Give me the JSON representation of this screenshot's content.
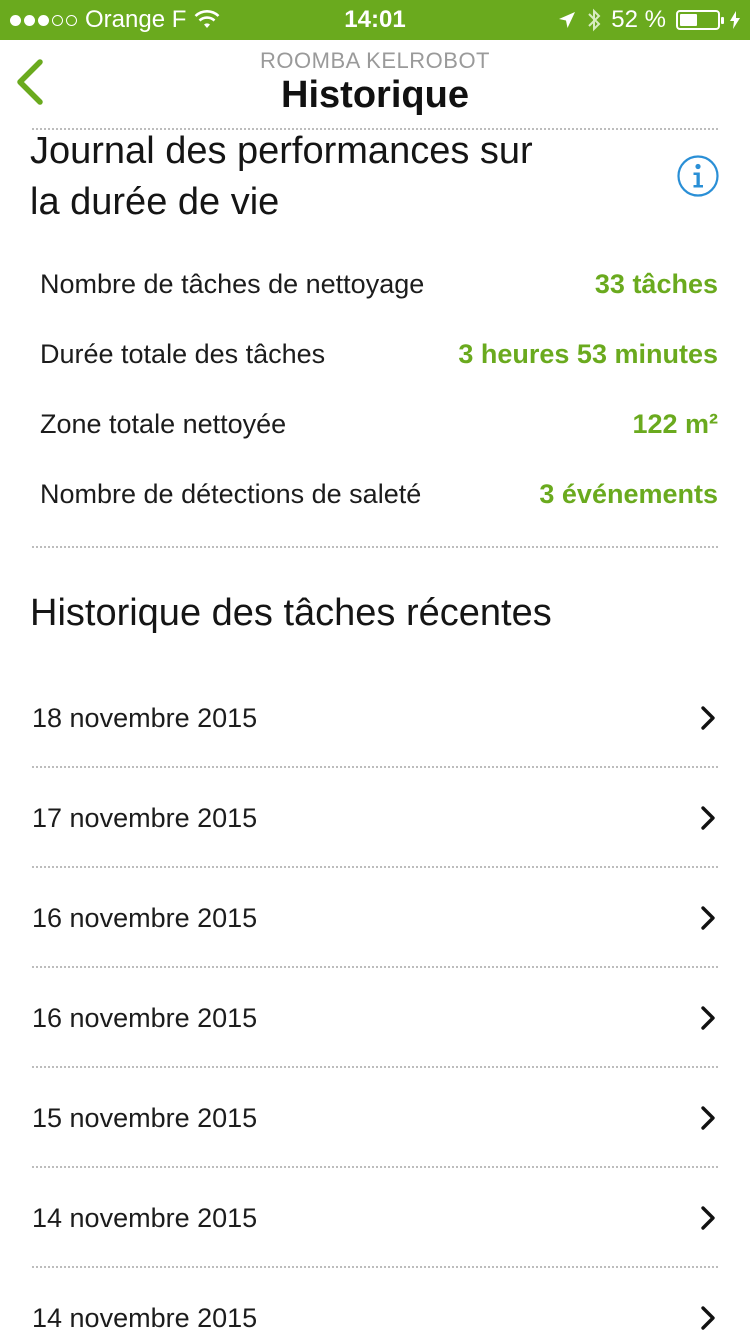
{
  "status_bar": {
    "carrier": "Orange F",
    "time": "14:01",
    "battery_percent": "52 %",
    "battery_level": 0.52,
    "icons": [
      "wifi-icon",
      "location-arrow-icon",
      "bluetooth-icon",
      "battery-icon",
      "charging-icon"
    ]
  },
  "nav": {
    "subtitle": "ROOMBA KELROBOT",
    "title": "Historique",
    "back_icon": "chevron-left-icon"
  },
  "lifetime": {
    "title_line1": "Journal des performances sur",
    "title_line2": "la durée de vie",
    "info_icon": "info-circle-icon",
    "stats": [
      {
        "label": "Nombre de tâches de nettoyage",
        "value": "33 tâches"
      },
      {
        "label": "Durée totale des tâches",
        "value": "3 heures 53 minutes"
      },
      {
        "label": "Zone totale nettoyée",
        "value": "122 m²"
      },
      {
        "label": "Nombre de détections de saleté",
        "value": "3 événements"
      }
    ]
  },
  "history": {
    "title": "Historique des tâches récentes",
    "items": [
      {
        "label": "18 novembre 2015"
      },
      {
        "label": "17 novembre 2015"
      },
      {
        "label": "16 novembre 2015"
      },
      {
        "label": "16 novembre 2015"
      },
      {
        "label": "15 novembre 2015"
      },
      {
        "label": "14 novembre 2015"
      },
      {
        "label": "14 novembre 2015"
      }
    ]
  },
  "colors": {
    "accent": "#6aaa1e",
    "info_blue": "#2a8fd6"
  }
}
